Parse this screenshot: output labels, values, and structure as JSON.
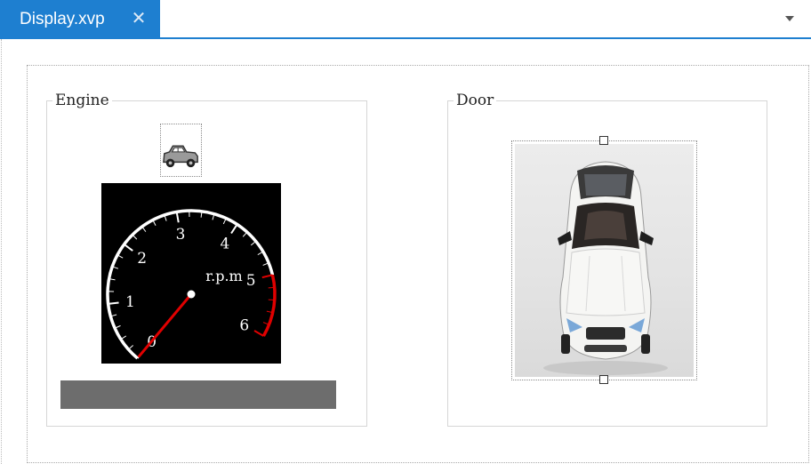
{
  "tab": {
    "title": "Display.xvp",
    "close_glyph": "✕"
  },
  "groups": {
    "engine": {
      "title": "Engine"
    },
    "door": {
      "title": "Door"
    }
  },
  "gauge": {
    "unit_label": "r.p.m",
    "ticks": [
      "0",
      "1",
      "2",
      "3",
      "4",
      "5",
      "6"
    ],
    "value": 0.0,
    "redline_from": 5,
    "colors": {
      "face": "#000000",
      "scale": "#ffffff",
      "redline": "#e00000",
      "needle": "#e00000"
    }
  },
  "icons": {
    "car_symbol": "car-icon",
    "tab_dropdown": "chevron-down-icon"
  },
  "colors": {
    "accent": "#1e7fd0",
    "bar": "#6d6d6d"
  }
}
